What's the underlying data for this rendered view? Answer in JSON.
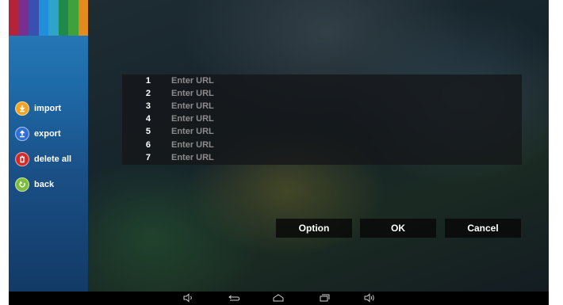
{
  "colors": {
    "import_icon": "#f2a424",
    "export_icon": "#2f6fd6",
    "delete_icon": "#d62b2b",
    "back_icon": "#7dbf3c",
    "stripes": [
      "#b3233a",
      "#7a2f8e",
      "#3b4fb0",
      "#1e8fd8",
      "#2fa3c8",
      "#1f8a4a",
      "#3ea13a",
      "#e58a1c"
    ]
  },
  "sidebar": {
    "items": [
      {
        "label": "import",
        "icon": "download-icon"
      },
      {
        "label": "export",
        "icon": "upload-icon"
      },
      {
        "label": "delete all",
        "icon": "trash-icon"
      },
      {
        "label": "back",
        "icon": "back-icon"
      }
    ]
  },
  "url_list": {
    "rows": [
      {
        "num": "1",
        "placeholder": "Enter URL"
      },
      {
        "num": "2",
        "placeholder": "Enter URL"
      },
      {
        "num": "3",
        "placeholder": "Enter URL"
      },
      {
        "num": "4",
        "placeholder": "Enter URL"
      },
      {
        "num": "5",
        "placeholder": "Enter URL"
      },
      {
        "num": "6",
        "placeholder": "Enter URL"
      },
      {
        "num": "7",
        "placeholder": "Enter URL"
      }
    ]
  },
  "buttons": {
    "option": "Option",
    "ok": "OK",
    "cancel": "Cancel"
  },
  "navbar": {
    "icons": [
      "volume-down-icon",
      "back-arrow-icon",
      "home-icon",
      "recent-apps-icon",
      "volume-up-icon"
    ]
  }
}
